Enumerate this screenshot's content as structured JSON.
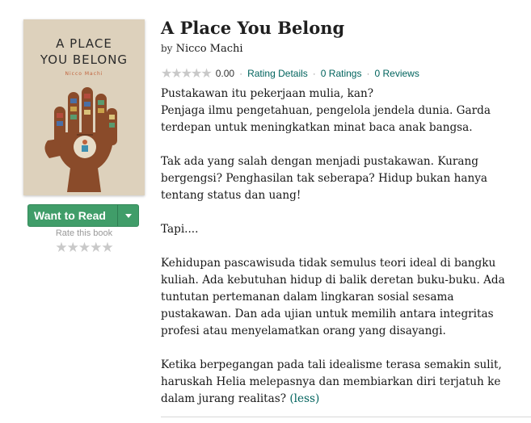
{
  "cover": {
    "title_line1": "A PLACE",
    "title_line2": "YOU BELONG",
    "author": "Nicco Machi"
  },
  "actions": {
    "want_to_read": "Want to Read",
    "rate_label": "Rate this book",
    "rate_stars": "★★★★★"
  },
  "book": {
    "title": "A Place You Belong",
    "by": "by",
    "author": "Nicco Machi",
    "stars": "★★★★★",
    "rating": "0.00",
    "rating_details": "Rating Details",
    "ratings": "0 Ratings",
    "reviews": "0 Reviews",
    "sep": "·"
  },
  "description": {
    "p1_l1": "Pustakawan itu pekerjaan mulia, kan?",
    "p1_l2": "Penjaga ilmu pengetahuan, pengelola jendela dunia. Garda terdepan untuk meningkatkan minat baca anak bangsa.",
    "p2": "Tak ada yang salah dengan menjadi pustakawan. Kurang bergengsi? Penghasilan tak seberapa? Hidup bukan hanya tentang status dan uang!",
    "p3": "Tapi....",
    "p4": "Kehidupan pascawisuda tidak semulus teori ideal di bangku kuliah. Ada kebutuhan hidup di balik deretan buku-buku. Ada tuntutan pertemanan dalam lingkaran sosial sesama pustakawan. Dan ada ujian untuk memilih antara integritas profesi atau menyelamatkan orang yang disayangi.",
    "p5": "Ketika berpegangan pada tali idealisme terasa semakin sulit, haruskah Helia melepasnya dan membiarkan diri terjatuh ke dalam jurang realitas?",
    "less": "(less)"
  }
}
